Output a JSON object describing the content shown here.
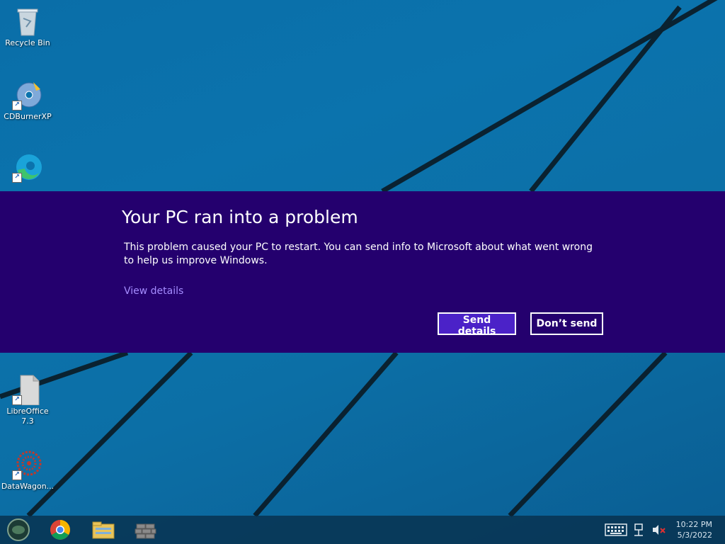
{
  "desktop": {
    "icons": [
      {
        "label": "Recycle Bin",
        "icon": "recycle-bin-icon"
      },
      {
        "label": "CDBurnerXP",
        "icon": "cdburner-icon"
      },
      {
        "label": "",
        "icon": "edge-icon"
      },
      {
        "label": "LibreOffice 7.3",
        "icon": "libreoffice-icon"
      },
      {
        "label": "DataWagon...",
        "icon": "datawagon-icon"
      }
    ]
  },
  "dialog": {
    "title": "Your PC ran into a problem",
    "message": "This problem caused your PC to restart. You can send info to Microsoft about what went wrong to help us improve Windows.",
    "view_details": "View details",
    "send_button": "Send details",
    "dont_send_button": "Don’t send",
    "background_color": "#24006e",
    "accent_color": "#4b22c8"
  },
  "taskbar": {
    "pinned": [
      "start-orb-icon",
      "chrome-icon",
      "file-explorer-icon",
      "firewall-icon"
    ],
    "tray": {
      "time": "10:22 PM",
      "date": "5/3/2022"
    }
  }
}
